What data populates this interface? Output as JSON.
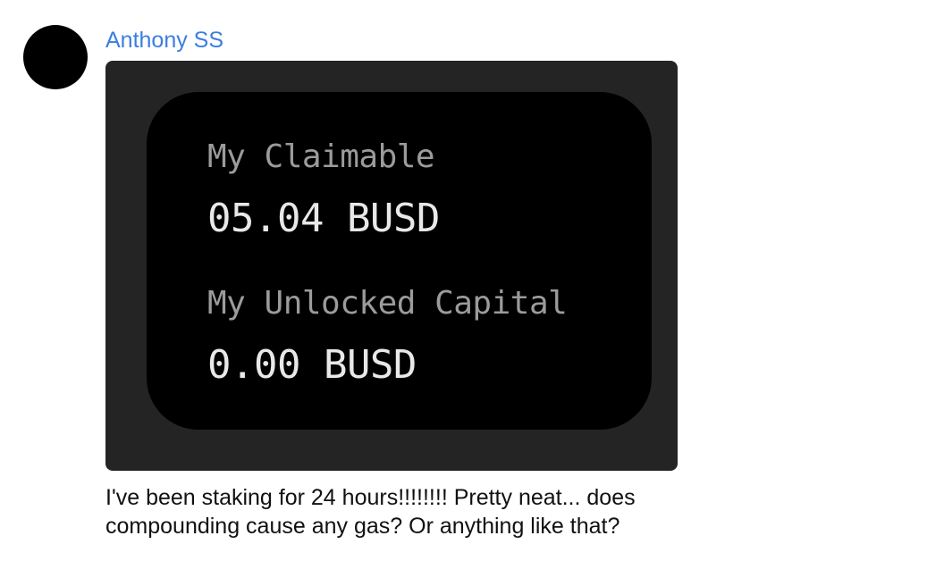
{
  "message": {
    "sender_name": "Anthony SS",
    "image": {
      "claimable_label": "My Claimable",
      "claimable_value": "05.04 BUSD",
      "unlocked_label": "My Unlocked Capital",
      "unlocked_value": "0.00 BUSD"
    },
    "text": "I've been staking for 24 hours!!!!!!!! Pretty neat... does compounding cause any gas? Or anything like that?"
  },
  "colors": {
    "sender_name": "#3b7ee0",
    "avatar": "#000000",
    "image_frame": "#242424",
    "card_background": "#000000"
  }
}
